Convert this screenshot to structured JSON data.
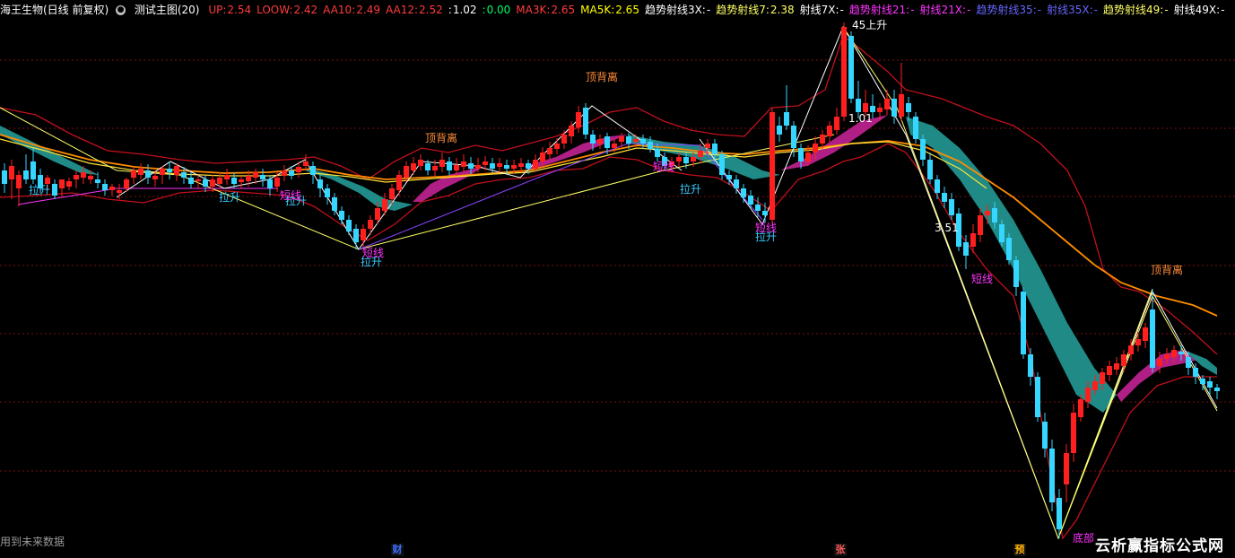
{
  "header": {
    "stock_name": "海王生物(日线 前复权)",
    "menu_icon": "gear-dot-icon",
    "indicator_title": "测试主图(20)",
    "values": [
      {
        "label": "UP:",
        "value": "2.54",
        "color": "#ff3b3b"
      },
      {
        "label": "LOOW:",
        "value": "2.42",
        "color": "#ff3b3b"
      },
      {
        "label": "AA10:",
        "value": "2.49",
        "color": "#ff3b3b"
      },
      {
        "label": "AA12:",
        "value": "2.52",
        "color": "#ff3b3b"
      },
      {
        "label": ":",
        "value": "1.02",
        "color": "#ffffff"
      },
      {
        "label": ":",
        "value": "0.00",
        "color": "#00ff66"
      },
      {
        "label": "MA3K:",
        "value": "2.65",
        "color": "#ff3b3b"
      },
      {
        "label": "MA5K:",
        "value": "2.65",
        "color": "#ffff00"
      },
      {
        "label": "趋势射线3X:",
        "value": "-",
        "color": "#ffffff"
      },
      {
        "label": "趋势射线7:",
        "value": "2.38",
        "color": "#ffff66"
      },
      {
        "label": "射线7X:",
        "value": "-",
        "color": "#ffffff"
      },
      {
        "label": "趋势射线21:",
        "value": "-",
        "color": "#ff33ff"
      },
      {
        "label": "射线21X:",
        "value": "-",
        "color": "#ff33ff"
      },
      {
        "label": "趋势射线35:",
        "value": "-",
        "color": "#6666ff"
      },
      {
        "label": "射线35X:",
        "value": "-",
        "color": "#6666ff"
      },
      {
        "label": "趋势射线49:",
        "value": "-",
        "color": "#ffff66"
      },
      {
        "label": "射线49X:",
        "value": "-",
        "color": "#ffffff"
      }
    ]
  },
  "annotations": [
    {
      "text": "顶背离",
      "color": "#ff8c3a"
    },
    {
      "text": "顶背离",
      "color": "#ff8c3a"
    },
    {
      "text": "顶背离",
      "color": "#ff8c3a"
    },
    {
      "text": "拉升",
      "color": "#33ccff"
    },
    {
      "text": "拉升",
      "color": "#33ccff"
    },
    {
      "text": "拉升",
      "color": "#33ccff"
    },
    {
      "text": "拉升",
      "color": "#33ccff"
    },
    {
      "text": "拉升",
      "color": "#33ccff"
    },
    {
      "text": "拉升",
      "color": "#33ccff"
    },
    {
      "text": "短线",
      "color": "#ff33ff"
    },
    {
      "text": "短线",
      "color": "#ff33ff"
    },
    {
      "text": "短线",
      "color": "#ff33ff"
    },
    {
      "text": "短线",
      "color": "#ff33ff"
    },
    {
      "text": "短线",
      "color": "#ff33ff"
    },
    {
      "text": "3.51",
      "color": "#ffffff"
    },
    {
      "text": "45上升",
      "color": "#ffffff"
    },
    {
      "text": "1.01",
      "color": "#ffffff"
    },
    {
      "text": "底部",
      "color": "#ff33ff"
    }
  ],
  "bottom": {
    "note": "用到未来数据",
    "event_tags": [
      {
        "text": "财",
        "color": "#3b6cff"
      },
      {
        "text": "张",
        "color": "#ff5a5a"
      },
      {
        "text": "预",
        "color": "#ffb000"
      }
    ],
    "watermark": "云析赢指标公式网"
  },
  "colors": {
    "up": "#ff1f1f",
    "down": "#35d6ff",
    "teal": "#1f8a86",
    "magenta": "#b01f86",
    "band": "#c0101c",
    "ma_orange": "#ff8c00",
    "ma_yellow": "#ffe13a"
  },
  "chart_data": {
    "type": "candlestick",
    "price_high": "3.51",
    "price_low": "1.01"
  }
}
